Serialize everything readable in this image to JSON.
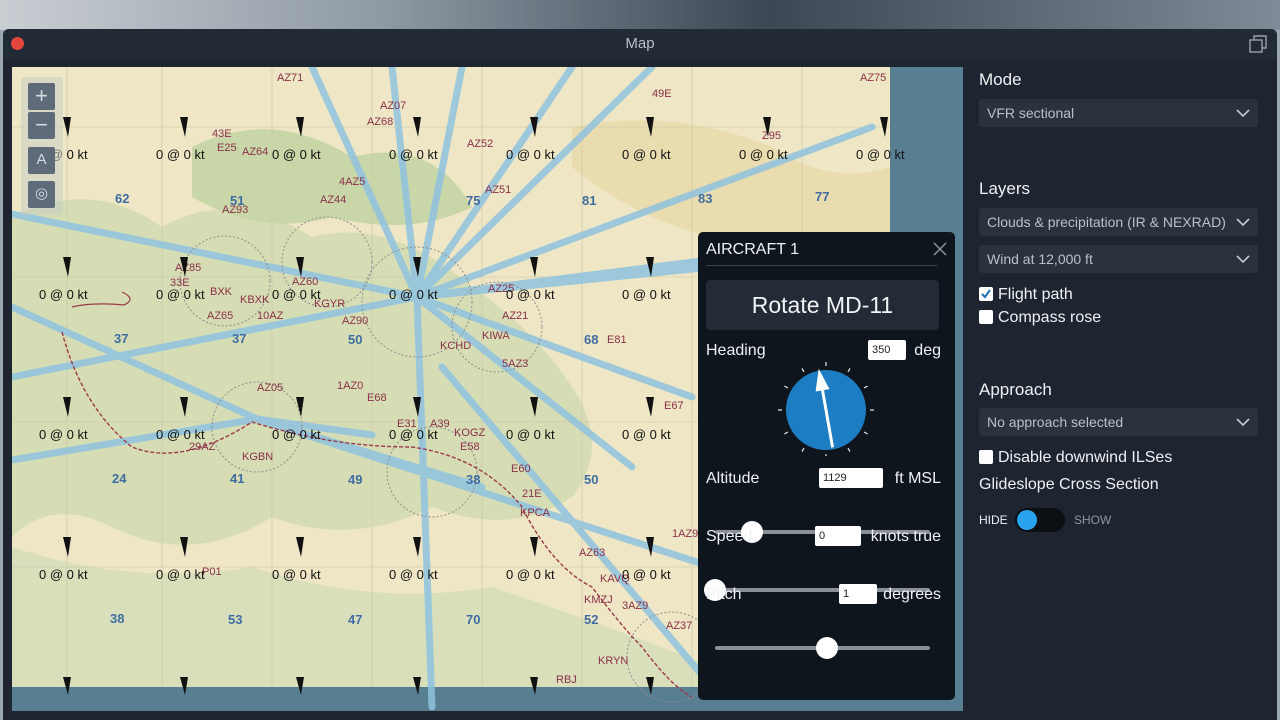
{
  "window": {
    "title": "Map"
  },
  "map": {
    "wind_label": "0 @ 0 kt",
    "grid_numbers": [
      "62",
      "51",
      "75",
      "81",
      "83",
      "77",
      "37",
      "37",
      "50",
      "68",
      "24",
      "41",
      "49",
      "38",
      "50",
      "38",
      "53",
      "47",
      "70",
      "52"
    ],
    "airport_labels": [
      "AZ71",
      "AZ07",
      "AZ68",
      "AZ52",
      "AZ51",
      "AZ75",
      "49E",
      "Z95",
      "43E",
      "E25",
      "AZ64",
      "4AZ5",
      "AZ44",
      "AZ93",
      "AZ85",
      "33E",
      "BXK",
      "KBXK",
      "AZ65",
      "10AZ",
      "AZ60",
      "KGYR",
      "AZ90",
      "AZ05",
      "E68",
      "KGBN",
      "29AZ",
      "1AZ0",
      "E31",
      "A39",
      "KOGZ",
      "E58",
      "E60",
      "21E",
      "KPCA",
      "AZ63",
      "KMZJ",
      "KAVQ",
      "AZ25",
      "AZ21",
      "5AZ3",
      "KIWA",
      "KCHD",
      "E81",
      "E67",
      "3AZ9",
      "AZ37",
      "KRYN",
      "RBJ",
      "P01",
      "1AZ9"
    ]
  },
  "panel": {
    "mode_heading": "Mode",
    "mode_value": "VFR sectional",
    "layers_heading": "Layers",
    "layer1": "Clouds & precipitation (IR & NEXRAD)",
    "layer2": "Wind at 12,000 ft",
    "flight_path_label": "Flight path",
    "flight_path_checked": true,
    "compass_rose_label": "Compass rose",
    "compass_rose_checked": false,
    "approach_heading": "Approach",
    "approach_value": "No approach selected",
    "disable_ils_label": "Disable downwind ILSes",
    "disable_ils_checked": false,
    "glideslope_label": "Glideslope Cross Section",
    "hide_label": "HIDE",
    "show_label": "SHOW"
  },
  "aircraft": {
    "title": "AIRCRAFT 1",
    "action_label": "Rotate MD-11",
    "heading_label": "Heading",
    "heading_value": "350",
    "heading_unit": "deg",
    "altitude_label": "Altitude",
    "altitude_value": "1129",
    "altitude_unit": "ft MSL",
    "altitude_level": 0.17,
    "speed_label": "Speed",
    "speed_value": "0",
    "speed_unit": "knots true",
    "speed_level": 0.0,
    "pitch_label": "Pitch",
    "pitch_value": "1",
    "pitch_unit": "degrees",
    "pitch_level": 0.52
  },
  "colors": {
    "accent": "#29a3f0",
    "compass": "#1d7dc2",
    "map_land": "#eee6c4",
    "map_water": "#587e92",
    "routes": "#8fc3e0"
  }
}
